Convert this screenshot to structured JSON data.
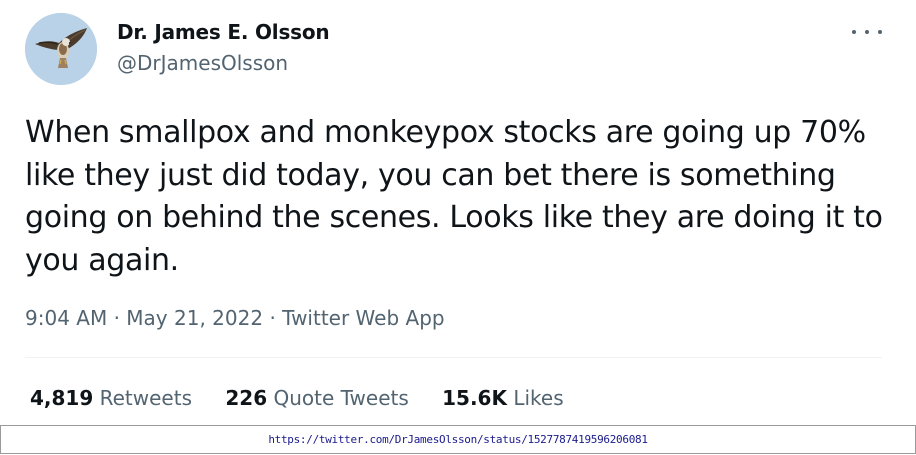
{
  "author": {
    "name": "Dr. James E. Olsson",
    "handle": "@DrJamesOlsson",
    "avatar_icon": "hawk-avatar-icon"
  },
  "tweet": {
    "text": "When smallpox and monkeypox stocks are going up 70% like they just did today, you can bet there is something going on behind the scenes. Looks like they are doing it to you again.",
    "time": "9:04 AM",
    "date": "May 21, 2022",
    "source": "Twitter Web App",
    "separator": "·"
  },
  "stats": {
    "retweets_count": "4,819",
    "retweets_label": "Retweets",
    "quotes_count": "226",
    "quotes_label": "Quote Tweets",
    "likes_count": "15.6K",
    "likes_label": "Likes"
  },
  "footer": {
    "url": "https://twitter.com/DrJamesOlsson/status/1527787419596206081"
  },
  "colors": {
    "text": "#0f1419",
    "secondary": "#536471",
    "divider": "#eff3f4",
    "link": "#1a1a8c"
  },
  "icons": {
    "more": "more-options-icon"
  }
}
